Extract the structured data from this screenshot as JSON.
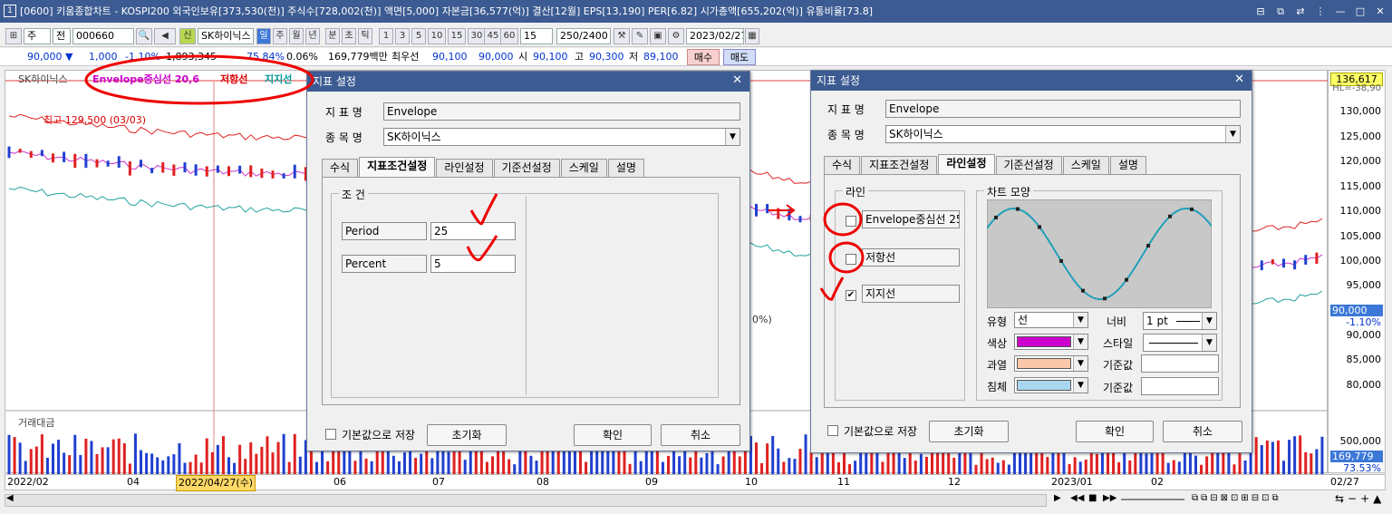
{
  "window": {
    "icon": "1",
    "title": "[0600] 키움종합차트 - KOSPI200 외국인보유[373,530(천)] 주식수[728,002(천)] 액면[5,000] 자본금[36,577(억)] 결산[12월] EPS[13,190] PER[6.82] 시가총액[655,202(억)] 유통비율[73.8]",
    "buttons": [
      "⊟",
      "⧉",
      "⇄",
      "⋮",
      "—",
      "□",
      "✕"
    ]
  },
  "toolbar": {
    "period_type": "주",
    "all": "전",
    "code": "000660",
    "sin": "신",
    "stock_name": "SK하이닉스",
    "period_buttons": [
      "일",
      "주",
      "월",
      "년",
      "분",
      "초",
      "틱"
    ],
    "intervals": [
      "1",
      "3",
      "5",
      "10",
      "15",
      "30",
      "45",
      "60"
    ],
    "interval_value": "15",
    "count": "250/2400",
    "date": "2023/02/27"
  },
  "quote": {
    "price": "90,000 ▼",
    "change": "1,000",
    "change_pct": "-1.10%",
    "volume": "1,893,345",
    "vol_ratio": "75.84%",
    "rate": "0.06%",
    "amount": "169,779백만",
    "best_label": "최우선",
    "best_ask": "90,100",
    "best_bid": "90,000",
    "open_label": "시",
    "open": "90,100",
    "high_label": "고",
    "high": "90,300",
    "low_label": "저",
    "low": "89,100",
    "buy": "매수",
    "sell": "매도"
  },
  "chart": {
    "stock_label": "SK하이닉스",
    "legend": [
      {
        "text": "Envelope중심선 20,6",
        "color": "#cc00cc"
      },
      {
        "text": "저항선",
        "color": "#dd0000"
      },
      {
        "text": "지지선",
        "color": "#009999"
      }
    ],
    "high_note": "최고 129,500 (03/03)",
    "partial_note": "0%)",
    "volume_label": "거래대금"
  },
  "axis": {
    "top_price": "136,617",
    "top_note": "HL=-38,90",
    "ticks": [
      "130,000",
      "125,000",
      "120,000",
      "115,000",
      "110,000",
      "105,000",
      "100,000",
      "95,000",
      "90,000",
      "85,000",
      "80,000",
      "75,000"
    ],
    "current_price": "90,000",
    "current_pct": "-1.10%",
    "vol_ticks": [
      "500,000"
    ],
    "vol_current": "169,779",
    "vol_pct": "73.53%"
  },
  "dates": [
    "2022/02",
    "04",
    "2022/04/27(수)",
    "06",
    "07",
    "08",
    "09",
    "10",
    "11",
    "12",
    "2023/01",
    "02",
    "02/27"
  ],
  "dialog1": {
    "title": "지표 설정",
    "name_label": "지 표 명",
    "name_value": "Envelope",
    "stock_label": "종 목 명",
    "stock_value": "SK하이닉스",
    "tabs": [
      "수식",
      "지표조건설정",
      "라인설정",
      "기준선설정",
      "스케일",
      "설명"
    ],
    "active_tab": 1,
    "group_title": "조 건",
    "params": [
      {
        "label": "Period",
        "value": "25"
      },
      {
        "label": "Percent",
        "value": "5"
      }
    ],
    "save_default": "기본값으로 저장",
    "reset": "초기화",
    "ok": "확인",
    "cancel": "취소"
  },
  "dialog2": {
    "title": "지표 설정",
    "name_label": "지 표 명",
    "name_value": "Envelope",
    "stock_label": "종 목 명",
    "stock_value": "SK하이닉스",
    "tabs": [
      "수식",
      "지표조건설정",
      "라인설정",
      "기준선설정",
      "스케일",
      "설명"
    ],
    "active_tab": 2,
    "line_group": "라인",
    "lines": [
      {
        "label": "Envelope중심선 25",
        "checked": false
      },
      {
        "label": "저항선",
        "checked": false
      },
      {
        "label": "지지선",
        "checked": true
      }
    ],
    "shape_group": "차트 모양",
    "type_label": "유형",
    "type_value": "선",
    "color_label": "색상",
    "color_value": "#cc00cc",
    "over_label": "과열",
    "over_color": "#f8c8a8",
    "under_label": "침체",
    "under_color": "#a8d8f0",
    "width_label": "너비",
    "width_value": "1 pt",
    "style_label": "스타일",
    "base_label1": "기준값",
    "base_label2": "기준값",
    "save_default": "기본값으로 저장",
    "reset": "초기화",
    "ok": "확인",
    "cancel": "취소"
  }
}
